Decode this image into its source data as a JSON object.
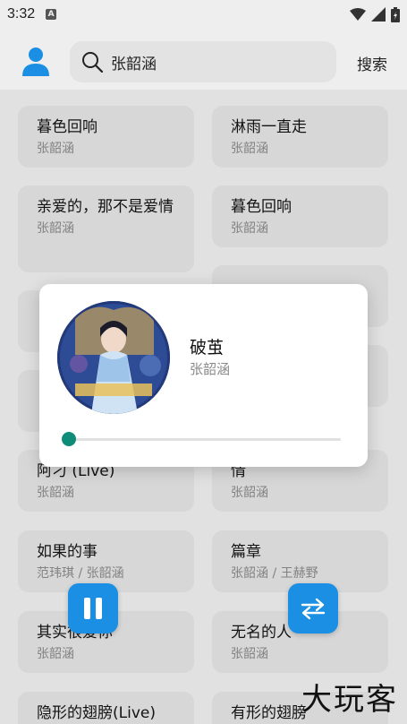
{
  "status": {
    "time": "3:32",
    "app_badge": "A"
  },
  "search": {
    "query": "张韶涵",
    "button_label": "搜索"
  },
  "songs": [
    {
      "title": "暮色回响",
      "artist": "张韶涵"
    },
    {
      "title": "淋雨一直走",
      "artist": "张韶涵"
    },
    {
      "title": "亲爱的，那不是爱情",
      "artist": "张韶涵"
    },
    {
      "title": "暮色回响",
      "artist": "张韶涵"
    },
    {
      "title": "阿刁 (Live)",
      "artist": "张韶涵"
    },
    {
      "title": "情",
      "artist": "张韶涵"
    },
    {
      "title": "如果的事",
      "artist": "范玮琪 / 张韶涵"
    },
    {
      "title": "篇章",
      "artist": "张韶涵 / 王赫野"
    },
    {
      "title": "其实很爱你",
      "artist": "张韶涵"
    },
    {
      "title": "无名的人",
      "artist": "张韶涵"
    },
    {
      "title": "隐形的翅膀(Live)",
      "artist": ""
    },
    {
      "title": "有形的翅膀",
      "artist": ""
    }
  ],
  "player": {
    "title": "破茧",
    "artist": "张韶涵",
    "progress": 0.0
  },
  "accent_color": "#1a8fe3",
  "seek_color": "#0e8c79",
  "watermark": "大玩客"
}
